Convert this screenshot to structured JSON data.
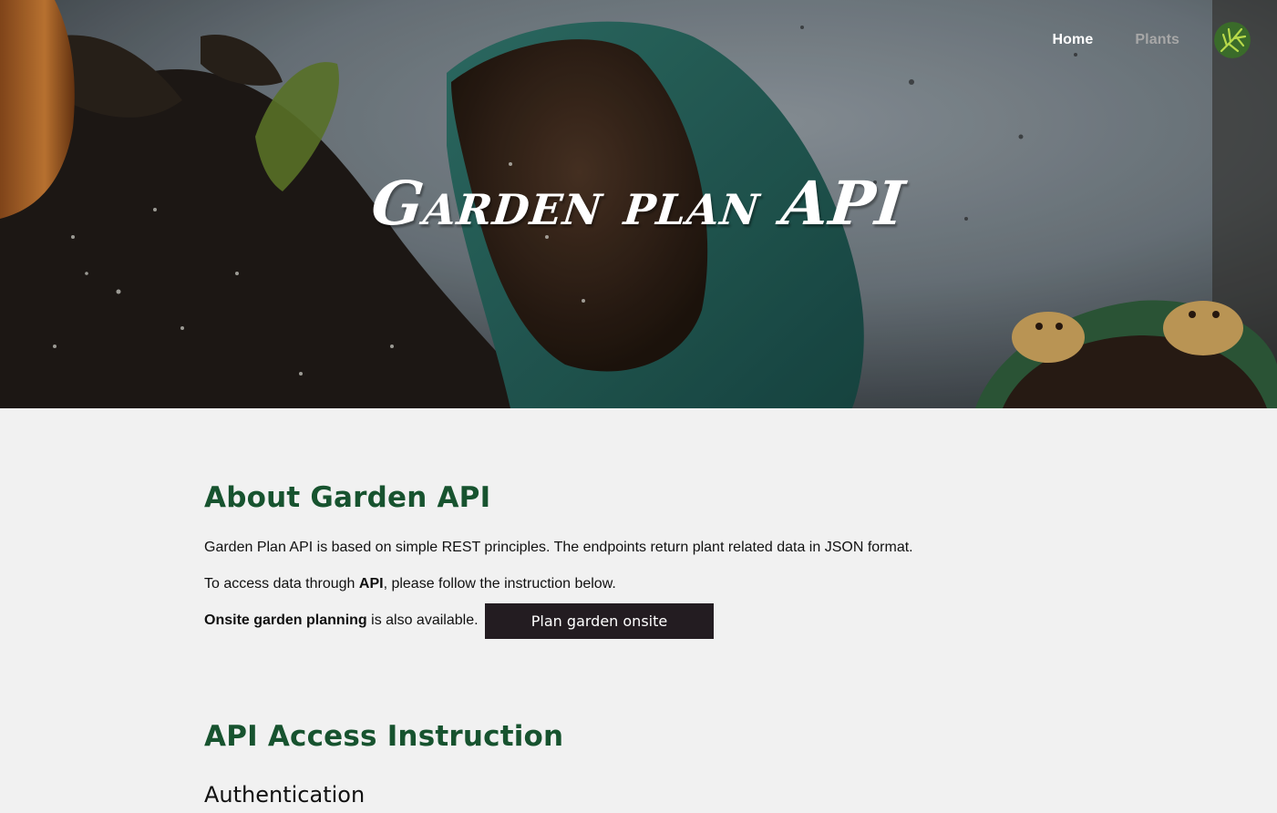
{
  "nav": {
    "home_label": "Home",
    "plants_label": "Plants"
  },
  "hero": {
    "title": "Garden plan API"
  },
  "about": {
    "title": "About Garden API",
    "line1": "Garden Plan API is based on simple REST principles. The endpoints return plant related data in JSON format.",
    "line2_pre": "To access data through ",
    "line2_bold": "API",
    "line2_post": ", please follow the instruction below.",
    "line3_bold": "Onsite garden planning",
    "line3_post": " is also available.",
    "plan_button_label": "Plan garden onsite"
  },
  "instructions": {
    "title": "API Access Instruction",
    "subtitle": "Authentication"
  },
  "colors": {
    "heading_green": "#17532f",
    "button_dark": "#231c21",
    "page_background": "#f1f1f1"
  }
}
